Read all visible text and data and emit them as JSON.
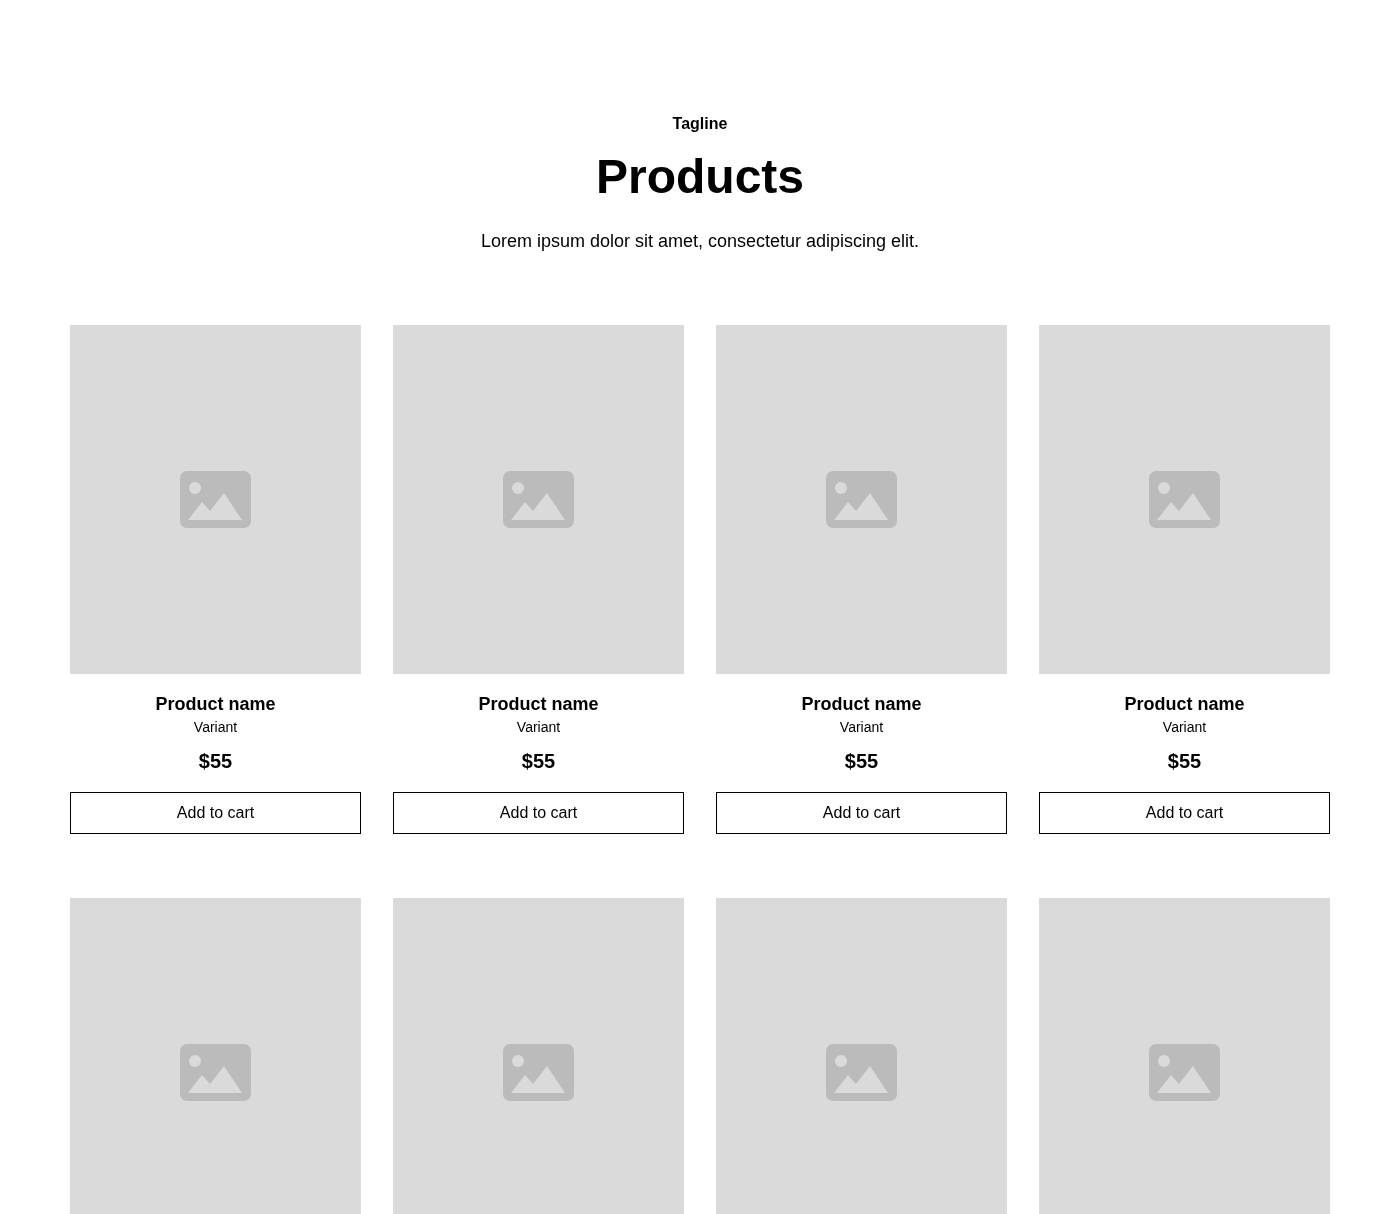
{
  "header": {
    "tagline": "Tagline",
    "title": "Products",
    "description": "Lorem ipsum dolor sit amet, consectetur adipiscing elit."
  },
  "products": [
    {
      "kind": "full",
      "name": "Product name",
      "variant": "Variant",
      "price": "$55",
      "button": "Add to cart"
    },
    {
      "kind": "full",
      "name": "Product name",
      "variant": "Variant",
      "price": "$55",
      "button": "Add to cart"
    },
    {
      "kind": "full",
      "name": "Product name",
      "variant": "Variant",
      "price": "$55",
      "button": "Add to cart"
    },
    {
      "kind": "full",
      "name": "Product name",
      "variant": "Variant",
      "price": "$55",
      "button": "Add to cart"
    },
    {
      "kind": "image_only"
    },
    {
      "kind": "image_only"
    },
    {
      "kind": "image_only"
    },
    {
      "kind": "image_only"
    }
  ]
}
